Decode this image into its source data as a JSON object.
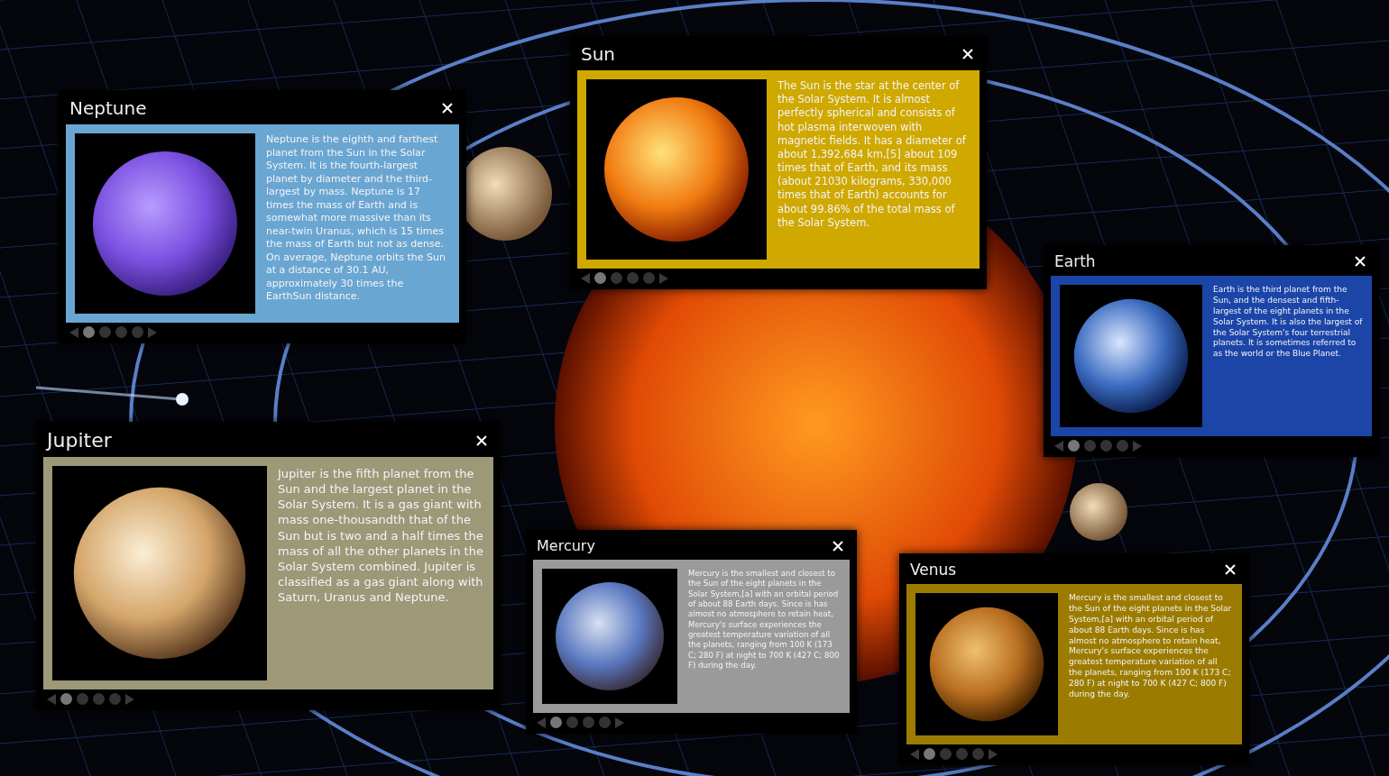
{
  "cards": [
    {
      "title": "Neptune",
      "color": "#6aa6d2",
      "text": "Neptune is the eighth and farthest planet from the Sun in the Solar System. It is the fourth-largest planet by diameter and the third-largest by mass. Neptune is 17 times the mass of Earth and is somewhat more massive than its near-twin Uranus, which is 15 times the mass of Earth but not as dense. On average, Neptune orbits the Sun at a distance of 30.1 AU, approximately 30 times the EarthSun distance.",
      "pages": [
        {
          "selected": true
        },
        {
          "selected": false
        },
        {
          "selected": false
        },
        {
          "selected": false
        }
      ]
    },
    {
      "title": "Sun",
      "color": "#cfa800",
      "text": "The Sun is the star at the center of the Solar System. It is almost perfectly spherical and consists of hot plasma interwoven with magnetic fields. It has a diameter of about 1,392,684 km,[5] about 109 times that of Earth, and its mass (about 21030 kilograms, 330,000 times that of Earth) accounts for about 99.86% of the total mass of the Solar System.",
      "pages": [
        {
          "selected": true
        },
        {
          "selected": false
        },
        {
          "selected": false
        },
        {
          "selected": false
        }
      ]
    },
    {
      "title": "Earth",
      "color": "#1c45a8",
      "text": "Earth is the third planet from the Sun, and the densest and fifth-largest of the eight planets in the Solar System. It is also the largest of the Solar System's four terrestrial planets. It is sometimes referred to as the world or the Blue Planet.",
      "pages": [
        {
          "selected": true
        },
        {
          "selected": false
        },
        {
          "selected": false
        },
        {
          "selected": false
        }
      ]
    },
    {
      "title": "Jupiter",
      "color": "#9c9878",
      "text": "Jupiter is the fifth planet from the Sun and the largest planet in the Solar System. It is a gas giant with mass one-thousandth that of the Sun but is two and a half times the mass of all the other planets in the Solar System combined. Jupiter is classified as a gas giant along with Saturn, Uranus and Neptune.",
      "pages": [
        {
          "selected": true
        },
        {
          "selected": false
        },
        {
          "selected": false
        },
        {
          "selected": false
        }
      ]
    },
    {
      "title": "Mercury",
      "color": "#9a9a9a",
      "text": "Mercury is the smallest and closest to the Sun of the eight planets in the Solar System,[a] with an orbital period of about 88 Earth days. Since is has almost no atmosphere to retain heat, Mercury's surface experiences the greatest temperature variation of all the planets, ranging from 100 K (173 C; 280 F) at night to 700 K (427 C; 800 F) during the day.",
      "pages": [
        {
          "selected": true
        },
        {
          "selected": false
        },
        {
          "selected": false
        },
        {
          "selected": false
        }
      ]
    },
    {
      "title": "Venus",
      "color": "#9c7c00",
      "text": "Mercury is the smallest and closest to the Sun of the eight planets in the Solar System,[a] with an orbital period of about 88 Earth days. Since is has almost no atmosphere to retain heat, Mercury's surface experiences the greatest temperature variation of all the planets, ranging from 100 K (173 C; 280 F) at night to 700 K (427 C; 800 F) during the day.",
      "pages": [
        {
          "selected": true
        },
        {
          "selected": false
        },
        {
          "selected": false
        },
        {
          "selected": false
        }
      ]
    }
  ]
}
